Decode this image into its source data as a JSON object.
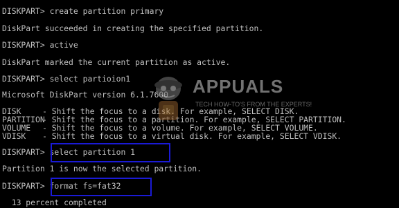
{
  "console": {
    "lines": [
      "DISKPART> create partition primary",
      "DiskPart succeeded in creating the specified partition.",
      "DISKPART> active",
      "DiskPart marked the current partition as active.",
      "DISKPART> select partioion1",
      "Microsoft DiskPart version 6.1.7600"
    ],
    "help_rows": [
      {
        "key": "DISK",
        "desc": "- Shift the focus to a disk. For example, SELECT DISK."
      },
      {
        "key": "PARTITION",
        "desc": "- Shift the focus to a partition. For example, SELECT PARTITION."
      },
      {
        "key": "VOLUME",
        "desc": "- Shift the focus to a volume. For example, SELECT VOLUME."
      },
      {
        "key": "VDISK",
        "desc": "- Shift the focus to a virtual disk. For example, SELECT VDISK."
      }
    ],
    "prompt_select": "DISKPART> select partition 1",
    "select_result": "Partition 1 is now the selected partition.",
    "prompt_format": "DISKPART> format fs=fat32",
    "progress_text": "  13 percent completed"
  },
  "watermark": {
    "brand": "APPUALS",
    "tagline": "TECH HOW-TO'S FROM THE EXPERTS!"
  },
  "colors": {
    "background": "#000000",
    "text": "#c0c0c0",
    "highlight_box": "#1a1ad6"
  }
}
